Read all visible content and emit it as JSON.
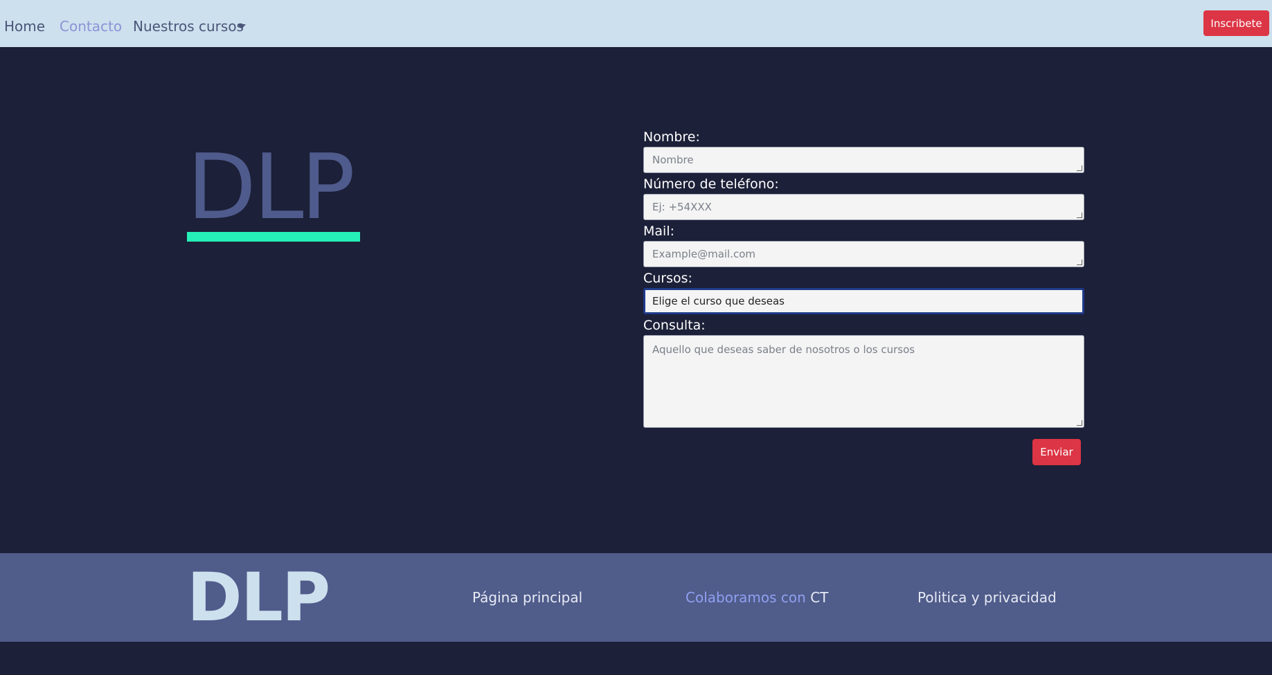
{
  "navbar": {
    "links": [
      "Home",
      "Contacto",
      "Nuestros cursos"
    ],
    "cta_label": "Inscribete"
  },
  "hero": {
    "logo_text": "DLP"
  },
  "form": {
    "nombre_label": "Nombre:",
    "nombre_placeholder": "Nombre",
    "telefono_label": "Número de teléfono:",
    "telefono_placeholder": "Ej: +54XXX",
    "mail_label": "Mail:",
    "mail_placeholder": "Example@mail.com",
    "cursos_label": "Cursos:",
    "cursos_selected": "Elige el curso que deseas",
    "consulta_label": "Consulta:",
    "consulta_placeholder": "Aquello que deseas saber de nosotros o los cursos",
    "submit_label": "Enviar"
  },
  "footer": {
    "logo_text": "DLP",
    "link_home": "Página principal",
    "link_collab_prefix": "Colaboramos con",
    "link_collab_suffix": "CT",
    "link_privacy": "Politica y privacidad"
  },
  "colors": {
    "page_bg": "#1c2038",
    "navbar_bg": "#cde0ee",
    "footer_bg": "#505c8a",
    "accent_red": "#dc3545",
    "underline_green": "#25f0b8",
    "link_active": "#8b93d6"
  }
}
